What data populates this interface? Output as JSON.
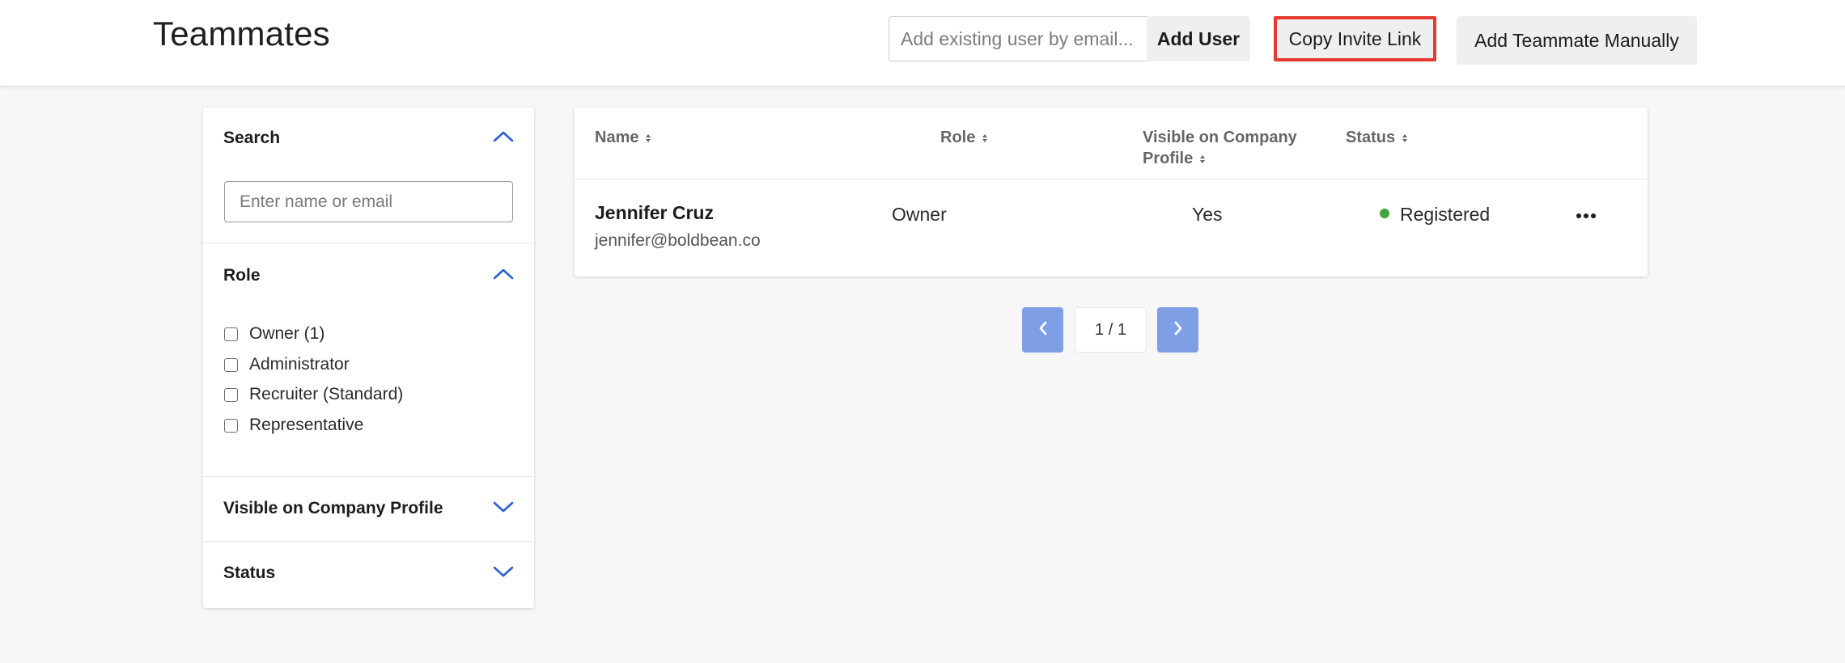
{
  "header": {
    "title": "Teammates",
    "email_placeholder": "Add existing user by email...",
    "add_user_label": "Add User",
    "copy_invite_label": "Copy Invite Link",
    "add_manual_label": "Add Teammate Manually",
    "highlight_color": "#e53a2f"
  },
  "filters": {
    "search": {
      "heading": "Search",
      "placeholder": "Enter name or email",
      "expanded": true
    },
    "role": {
      "heading": "Role",
      "expanded": true,
      "options": [
        {
          "label": "Owner (1)",
          "checked": false
        },
        {
          "label": "Administrator",
          "checked": false
        },
        {
          "label": "Recruiter (Standard)",
          "checked": false
        },
        {
          "label": "Representative",
          "checked": false
        }
      ]
    },
    "visible": {
      "heading": "Visible on Company Profile",
      "expanded": false
    },
    "status": {
      "heading": "Status",
      "expanded": false
    }
  },
  "table": {
    "columns": [
      {
        "label": "Name",
        "sortable": true
      },
      {
        "label": "Role",
        "sortable": true
      },
      {
        "label": "Visible on Company",
        "label2": "Profile",
        "sortable": true
      },
      {
        "label": "Status",
        "sortable": true
      }
    ],
    "rows": [
      {
        "name": "Jennifer Cruz",
        "email": "jennifer@boldbean.co",
        "role": "Owner",
        "visible": "Yes",
        "status": "Registered",
        "status_color": "#3fa63c"
      }
    ]
  },
  "pagination": {
    "indicator": "1 / 1",
    "accent_color": "#7e9ee6"
  },
  "icons": {
    "chevron_up": "chevron-up-icon",
    "chevron_down": "chevron-down-icon",
    "sort": "sort-icon",
    "more": "more-horizontal-icon",
    "prev": "chevron-left-icon",
    "next": "chevron-right-icon"
  }
}
